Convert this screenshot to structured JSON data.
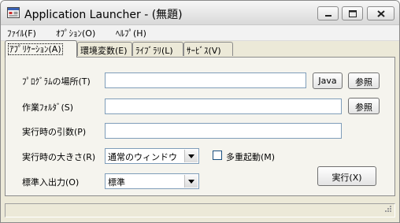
{
  "window": {
    "title": "Application Launcher - (無題)"
  },
  "menu": {
    "items": [
      {
        "label": "ﾌｧｲﾙ(F)"
      },
      {
        "label": "ｵﾌﾟｼｮﾝ(O)"
      },
      {
        "label": "ﾍﾙﾌﾟ(H)"
      }
    ]
  },
  "tabs": [
    {
      "label": "ｱﾌﾟﾘｹｰｼｮﾝ(A)",
      "active": true
    },
    {
      "label": "環境変数(E)",
      "active": false
    },
    {
      "label": "ﾗｲﾌﾞﾗﾘ(L)",
      "active": false
    },
    {
      "label": "ｻｰﾋﾞｽ(V)",
      "active": false
    }
  ],
  "form": {
    "program_label": "ﾌﾟﾛｸﾞﾗﾑの場所(T)",
    "program_value": "",
    "java_button": "Java",
    "browse_button_1": "参照",
    "folder_label": "作業ﾌｫﾙﾀﾞ(S)",
    "folder_value": "",
    "browse_button_2": "参照",
    "args_label": "実行時の引数(P)",
    "args_value": "",
    "size_label": "実行時の大きさ(R)",
    "size_value": "通常のウィンドウ",
    "multi_label": "多重起動(M)",
    "multi_checked": false,
    "io_label": "標準入出力(O)",
    "io_value": "標準",
    "run_button": "実行(X)"
  },
  "status": {
    "text": ""
  }
}
